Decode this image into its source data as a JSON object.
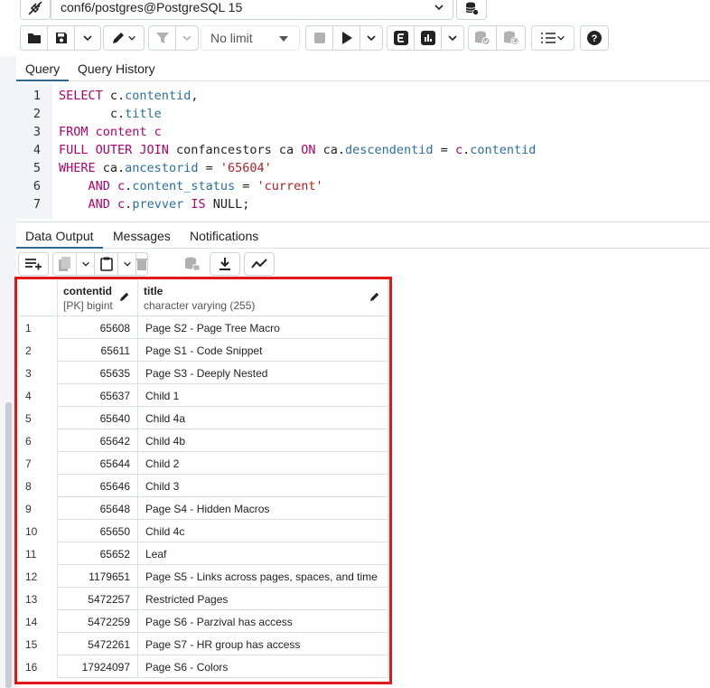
{
  "connection": {
    "title": "conf6/postgres@PostgreSQL 15"
  },
  "toolbar": {
    "limit_label": "No limit"
  },
  "query_tabs": [
    "Query",
    "Query History"
  ],
  "editor": {
    "lines": [
      {
        "n": "1",
        "tokens": [
          [
            "kw",
            "SELECT "
          ],
          [
            "plain",
            "c."
          ],
          [
            "fld",
            "contentid"
          ],
          [
            "plain",
            ","
          ]
        ]
      },
      {
        "n": "2",
        "tokens": [
          [
            "plain",
            "       c."
          ],
          [
            "fld",
            "title"
          ]
        ]
      },
      {
        "n": "3",
        "tokens": [
          [
            "kw",
            "FROM "
          ],
          [
            "kw",
            "content "
          ],
          [
            "kw",
            "c"
          ]
        ]
      },
      {
        "n": "4",
        "tokens": [
          [
            "kw",
            "FULL OUTER JOIN "
          ],
          [
            "plain",
            "confancestors ca "
          ],
          [
            "kw",
            "ON "
          ],
          [
            "plain",
            "ca."
          ],
          [
            "fld",
            "descendentid"
          ],
          [
            "plain",
            " = "
          ],
          [
            "kw",
            "c"
          ],
          [
            "plain",
            "."
          ],
          [
            "fld",
            "contentid"
          ]
        ]
      },
      {
        "n": "5",
        "tokens": [
          [
            "kw",
            "WHERE "
          ],
          [
            "plain",
            "ca."
          ],
          [
            "fld",
            "ancestorid"
          ],
          [
            "plain",
            " = "
          ],
          [
            "str",
            "'65604'"
          ]
        ]
      },
      {
        "n": "6",
        "tokens": [
          [
            "plain",
            "    "
          ],
          [
            "kw",
            "AND "
          ],
          [
            "kw",
            "c"
          ],
          [
            "plain",
            "."
          ],
          [
            "fld",
            "content_status"
          ],
          [
            "plain",
            " = "
          ],
          [
            "str",
            "'current'"
          ]
        ]
      },
      {
        "n": "7",
        "tokens": [
          [
            "plain",
            "    "
          ],
          [
            "kw",
            "AND "
          ],
          [
            "kw",
            "c"
          ],
          [
            "plain",
            "."
          ],
          [
            "fld",
            "prevver"
          ],
          [
            "plain",
            " "
          ],
          [
            "kw",
            "IS "
          ],
          [
            "plain",
            "NULL;"
          ]
        ]
      }
    ]
  },
  "output_tabs": [
    "Data Output",
    "Messages",
    "Notifications"
  ],
  "grid": {
    "columns": [
      {
        "name": "contentid",
        "type": "[PK] bigint"
      },
      {
        "name": "title",
        "type": "character varying (255)"
      }
    ],
    "rows": [
      {
        "n": "1",
        "contentid": "65608",
        "title": "Page S2 - Page Tree Macro"
      },
      {
        "n": "2",
        "contentid": "65611",
        "title": "Page S1 - Code Snippet"
      },
      {
        "n": "3",
        "contentid": "65635",
        "title": "Page S3 - Deeply Nested"
      },
      {
        "n": "4",
        "contentid": "65637",
        "title": "Child 1"
      },
      {
        "n": "5",
        "contentid": "65640",
        "title": "Child 4a"
      },
      {
        "n": "6",
        "contentid": "65642",
        "title": "Child 4b"
      },
      {
        "n": "7",
        "contentid": "65644",
        "title": "Child 2"
      },
      {
        "n": "8",
        "contentid": "65646",
        "title": "Child 3"
      },
      {
        "n": "9",
        "contentid": "65648",
        "title": "Page S4 - Hidden Macros"
      },
      {
        "n": "10",
        "contentid": "65650",
        "title": "Child 4c"
      },
      {
        "n": "11",
        "contentid": "65652",
        "title": "Leaf"
      },
      {
        "n": "12",
        "contentid": "1179651",
        "title": "Page S5 - Links across pages, spaces, and time"
      },
      {
        "n": "13",
        "contentid": "5472257",
        "title": "Restricted Pages"
      },
      {
        "n": "14",
        "contentid": "5472259",
        "title": "Page S6 - Parzival has access"
      },
      {
        "n": "15",
        "contentid": "5472261",
        "title": "Page S7 - HR group has access"
      },
      {
        "n": "16",
        "contentid": "17924097",
        "title": "Page S6 - Colors"
      }
    ]
  },
  "colors": {
    "keyword": "#b0006e",
    "field": "#2a6f9f",
    "string": "#b02222",
    "highlight": "#e01818",
    "active_tab": "#326690"
  }
}
